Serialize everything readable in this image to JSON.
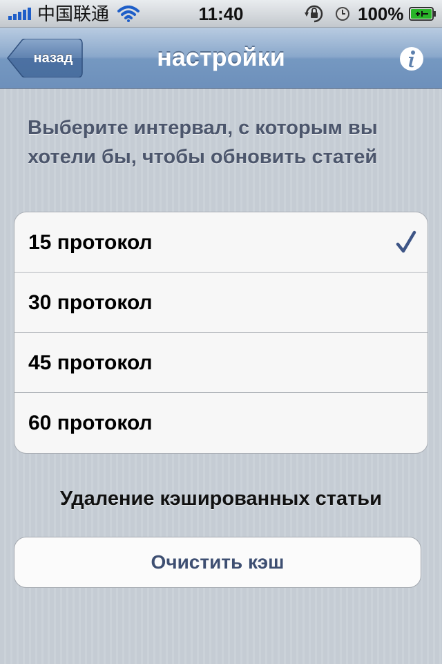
{
  "status_bar": {
    "carrier": "中国联通",
    "time": "11:40",
    "battery": "100%"
  },
  "nav": {
    "back_label": "назад",
    "title": "настройки"
  },
  "settings": {
    "interval_header": "Выберите интервал, с которым вы хотели бы, чтобы обновить статей",
    "options": [
      {
        "label": "15 протокол",
        "selected": true
      },
      {
        "label": "30 протокол",
        "selected": false
      },
      {
        "label": "45 протокол",
        "selected": false
      },
      {
        "label": "60 протокол",
        "selected": false
      }
    ],
    "cache_header": "Удаление кэшированных статьи",
    "clear_cache_label": "Очистить кэш"
  },
  "colors": {
    "nav_blue": "#7598c1",
    "accent_text": "#3e4f72",
    "checkmark": "#3e5586"
  },
  "icons": {
    "signal": "signal-bars-icon",
    "wifi": "wifi-icon",
    "lock": "rotation-lock-icon",
    "alarm": "alarm-clock-icon",
    "battery": "battery-charging-icon",
    "back": "back-arrow-button",
    "info": "info-icon",
    "check": "checkmark-icon"
  }
}
